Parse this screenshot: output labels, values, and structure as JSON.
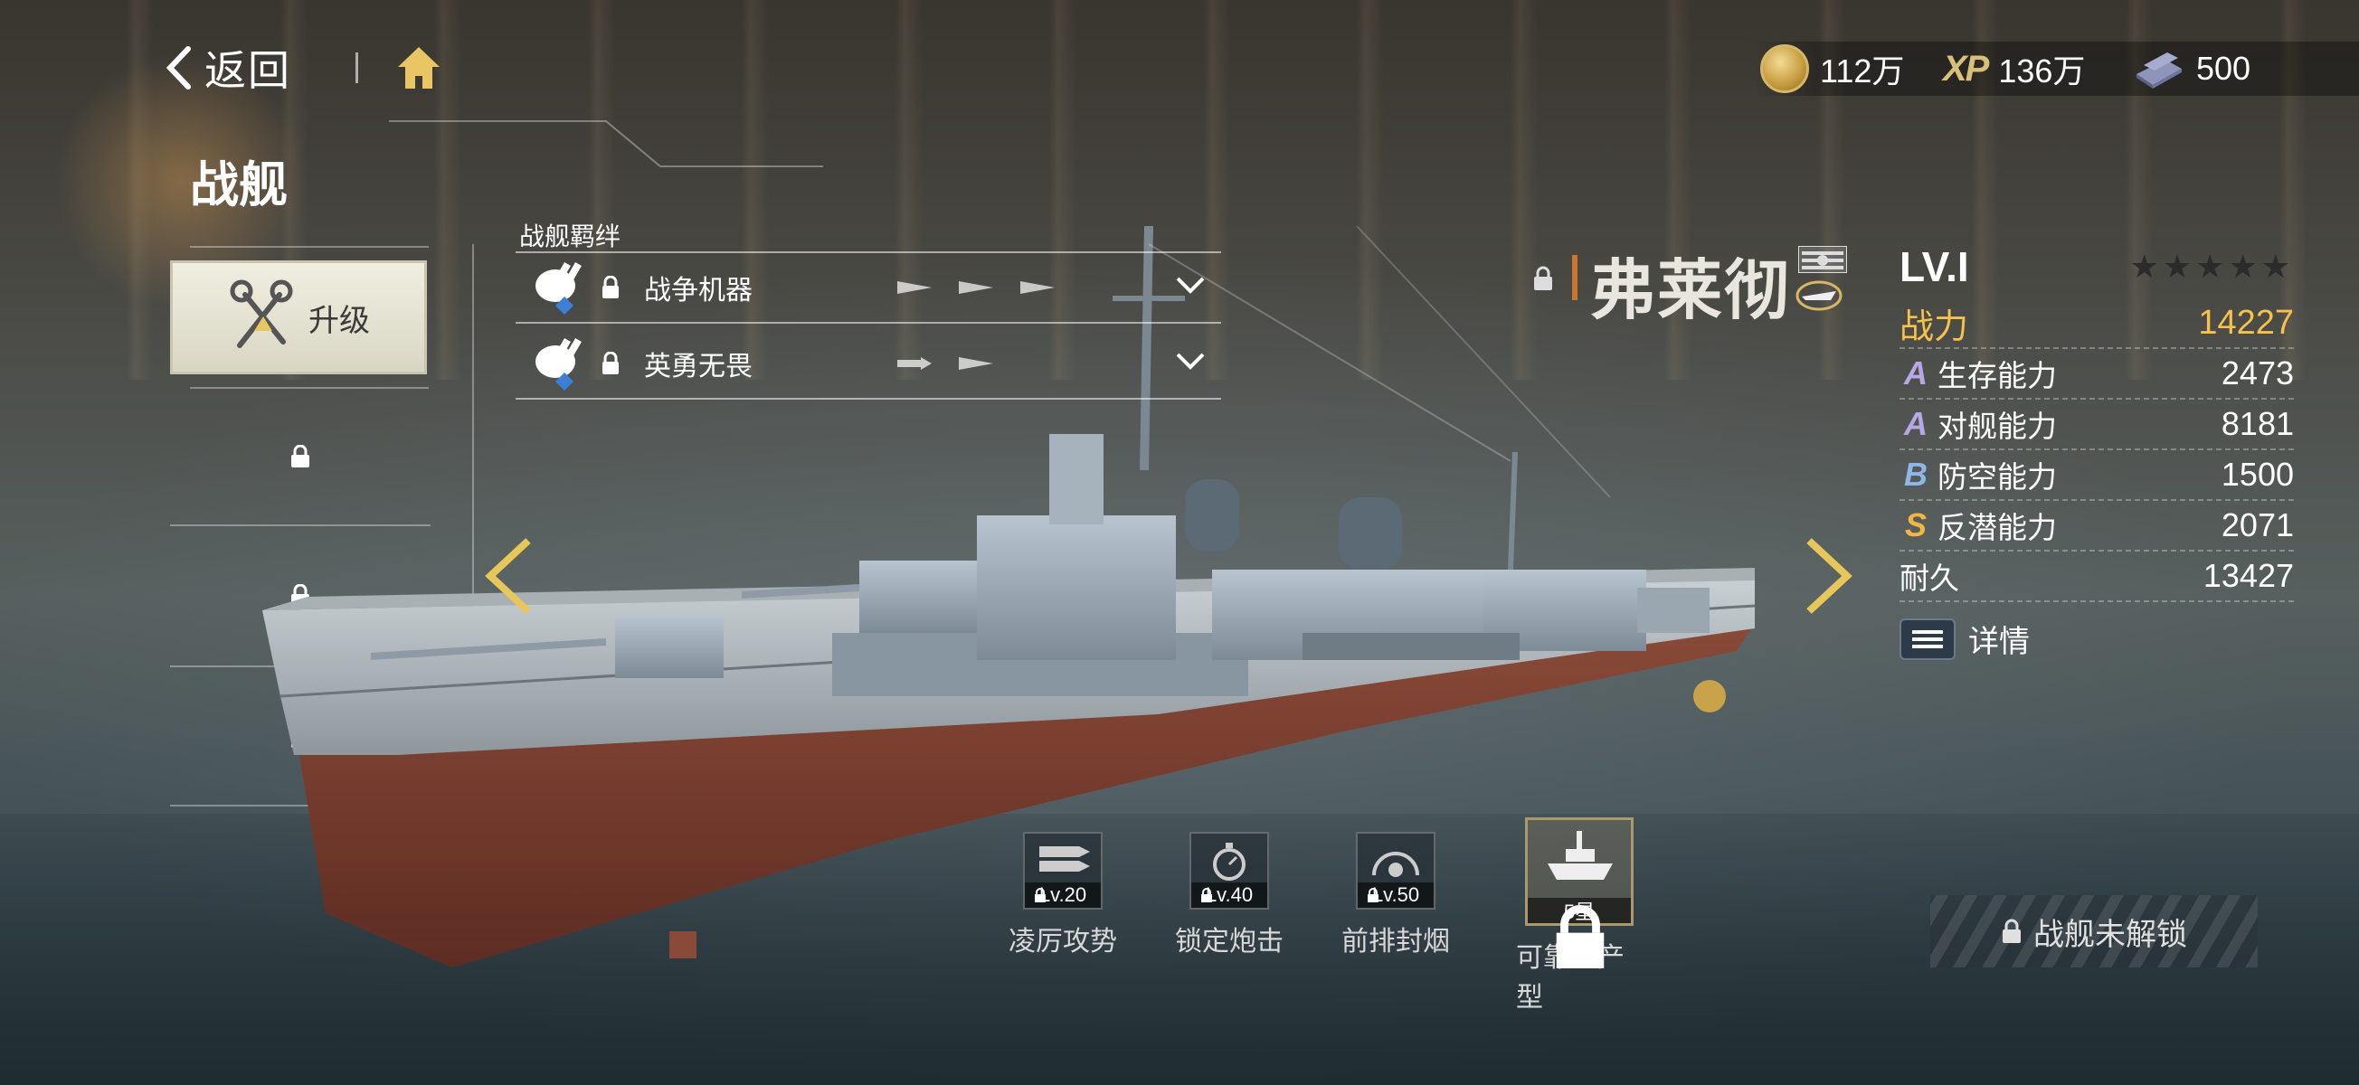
{
  "header": {
    "back_label": "返回",
    "page_title": "战舰"
  },
  "currencies": [
    {
      "icon": "coin-icon",
      "value": "112万"
    },
    {
      "icon": "xp-icon",
      "label": "XP",
      "value": "136万"
    },
    {
      "icon": "steel-icon",
      "value": "500"
    }
  ],
  "sidebar": {
    "upgrade_label": "升级"
  },
  "bonds": {
    "title": "战舰羁绊",
    "items": [
      {
        "name": "战争机器"
      },
      {
        "name": "英勇无畏"
      }
    ]
  },
  "ship": {
    "name": "弗莱彻",
    "level": "LV.I",
    "stars_filled": 0,
    "stars_total": 5
  },
  "stats": {
    "power_label": "战力",
    "power_value": "14227",
    "rows": [
      {
        "grade": "A",
        "label": "生存能力",
        "value": "2473",
        "grade_color": "#b7a7e6"
      },
      {
        "grade": "A",
        "label": "对舰能力",
        "value": "8181",
        "grade_color": "#b7a7e6"
      },
      {
        "grade": "B",
        "label": "防空能力",
        "value": "1500",
        "grade_color": "#8fb6e8"
      },
      {
        "grade": "S",
        "label": "反潜能力",
        "value": "2071",
        "grade_color": "#f2b742"
      }
    ],
    "durability_label": "耐久",
    "durability_value": "13427",
    "detail_label": "详情"
  },
  "skills": [
    {
      "name": "凌厉攻势",
      "requirement": "Lv.20"
    },
    {
      "name": "锁定炮击",
      "requirement": "Lv.40"
    },
    {
      "name": "前排封烟",
      "requirement": "Lv.50"
    },
    {
      "name": "可靠量产型",
      "requirement": "5星"
    }
  ],
  "unlock_label": "战舰未解锁",
  "colors": {
    "accent_gold": "#f5c24a",
    "arrow_gold": "#e8c75a"
  }
}
